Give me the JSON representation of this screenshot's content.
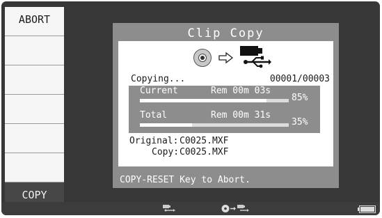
{
  "sidebar": {
    "buttons": [
      {
        "label": "ABORT"
      },
      {
        "label": ""
      },
      {
        "label": ""
      },
      {
        "label": ""
      },
      {
        "label": ""
      },
      {
        "label": ""
      },
      {
        "label": "COPY"
      }
    ]
  },
  "dialog": {
    "title": "Clip Copy",
    "icons": {
      "source": "disc-icon",
      "arrow": "arrow-right-icon",
      "destination": "usb-icon"
    },
    "status_label": "Copying...",
    "counter": "00001/00003",
    "current": {
      "label": "Current",
      "remaining": "Rem 00m 03s",
      "percent_text": "85%",
      "progress": 0.85
    },
    "total": {
      "label": "Total",
      "remaining": "Rem 00m 31s",
      "percent_text": "35%",
      "progress": 0.35
    },
    "original_label": "Original:",
    "original_file": "C0025.MXF",
    "copy_label": "Copy:",
    "copy_file": "C0025.MXF",
    "footer": "COPY-RESET Key to Abort."
  },
  "bottom_bar": {
    "icons": [
      "usb-icon",
      "disc-to-usb-icon",
      "battery-icon"
    ]
  }
}
